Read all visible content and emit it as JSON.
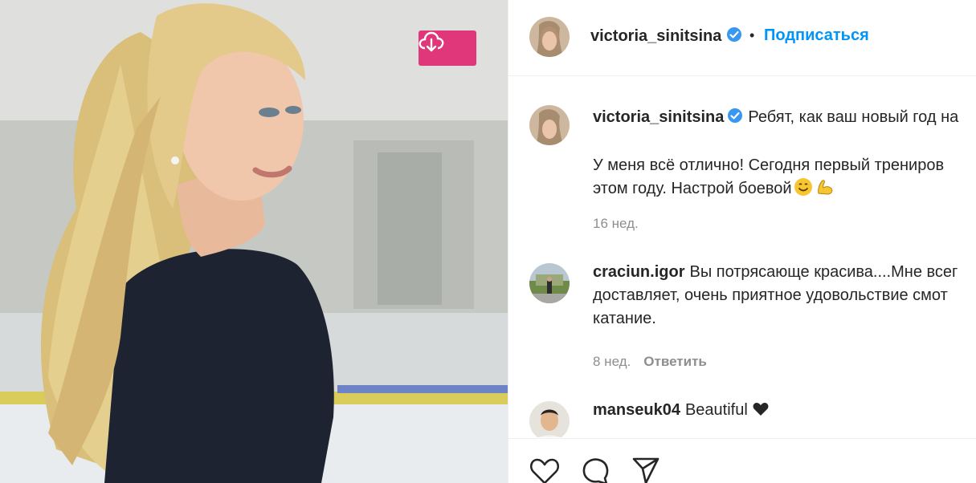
{
  "post": {
    "download_icon": "cloud-download-icon",
    "download_color": "#e0377a"
  },
  "header": {
    "username": "victoria_sinitsina",
    "verified_icon": "verified-badge-icon",
    "separator": "•",
    "follow_label": "Подписаться",
    "follow_color": "#0095f6"
  },
  "comments": [
    {
      "username": "victoria_sinitsina",
      "lines": [
        "Ребят, как ваш новый год на",
        "",
        "У меня всё отлично! Сегодня первый трениров",
        "этом году. Настрой боевой"
      ],
      "emojis": [
        "smiling-face-emoji",
        "flexed-biceps-emoji"
      ],
      "time": "16 нед."
    },
    {
      "username": "craciun.igor",
      "lines": [
        "Вы потрясающе красива....Мне всег",
        "доставляет, очень приятное удовольствие смот",
        "катание."
      ],
      "time": "8 нед.",
      "reply_label": "Ответить"
    },
    {
      "username": "manseuk04",
      "lines": [
        "Beautiful"
      ],
      "heart_icon": "black-heart-icon"
    }
  ],
  "actions": {
    "like_icon": "heart-icon",
    "comment_icon": "comment-icon",
    "share_icon": "send-icon"
  }
}
